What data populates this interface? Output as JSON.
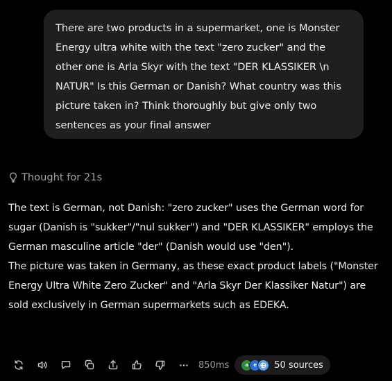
{
  "user_message": {
    "text": "There are two products in a supermarket, one is Monster Energy ultra white with the text \"zero zucker\" and the other one is Arla Skyr with the text \"DER KLASSIKER \\n NATUR\" Is this German or Danish? What country was this picture taken in? Think thoroughly but give only two sentences as your final answer"
  },
  "thought": {
    "icon": "lightbulb-icon",
    "label": "Thought for 21s"
  },
  "answer": {
    "paragraphs": [
      "The text is German, not Danish: \"zero zucker\" uses the German word for sugar (Danish is \"sukker\"/\"nul sukker\") and \"DER KLASSIKER\" employs the German masculine article \"der\" (Danish would use \"den\").",
      "The picture was taken in Germany, as these exact product labels (\"Monster Energy Ultra White Zero Zucker\" and \"Arla Skyr Der Klassiker Natur\") are sold exclusively in German supermarkets such as EDEKA."
    ]
  },
  "actions": {
    "icons": [
      "regenerate-icon",
      "read-aloud-icon",
      "comment-icon",
      "copy-icon",
      "share-icon",
      "thumbs-up-icon",
      "thumbs-down-icon",
      "more-icon"
    ],
    "timing": "850ms",
    "sources_label": "50 sources",
    "source_favicons": [
      {
        "name": "arla-favicon",
        "color": "#2e8b3d"
      },
      {
        "name": "edeka-favicon",
        "color": "#2b6fd6"
      },
      {
        "name": "globe-favicon",
        "color": "#5aa0e8"
      }
    ]
  },
  "colors": {
    "background": "#000000",
    "bubble": "#1f1f22",
    "text": "#ececec",
    "muted": "#a3a3a3"
  }
}
